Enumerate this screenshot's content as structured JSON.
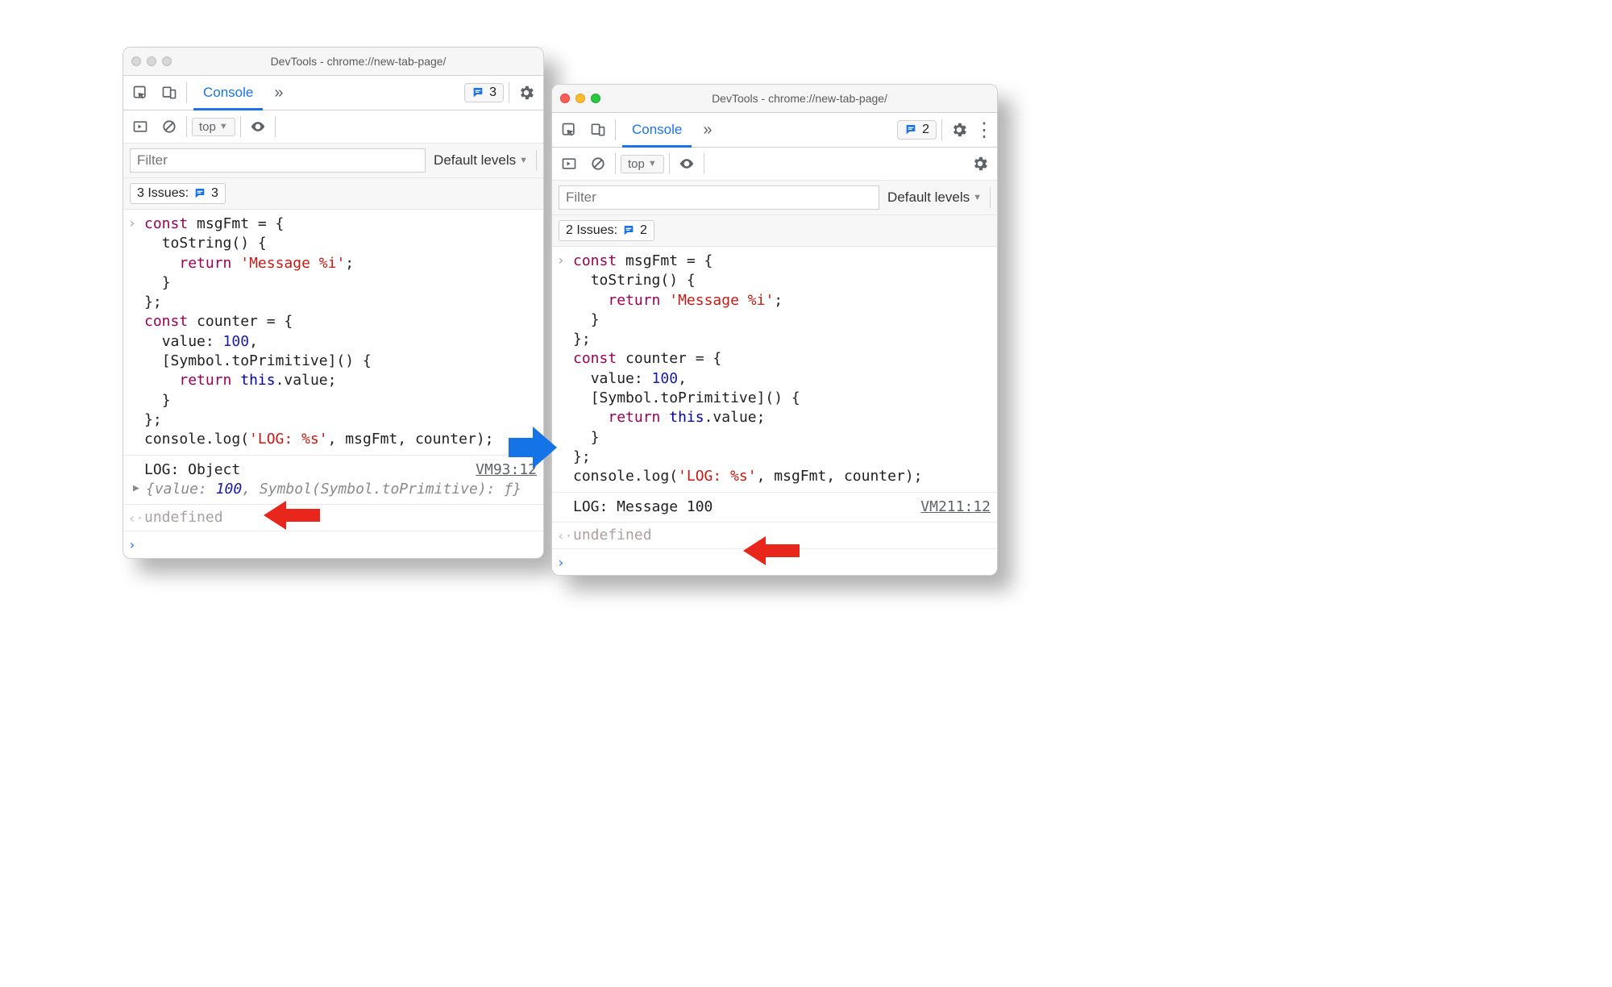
{
  "left": {
    "title": "DevTools - chrome://new-tab-page/",
    "traffic_active": false,
    "tab_label": "Console",
    "tabs_badge_count": 3,
    "context": "top",
    "filter_placeholder": "Filter",
    "levels_label": "Default levels",
    "issues_label": "3 Issues:",
    "issues_count": 3,
    "log_text": "LOG: Object",
    "log_src": "VM93:12",
    "expand_detail_html": "{value: <span class='num'>100</span>, Symbol(Symbol.toPrimitive): ƒ}",
    "undefined_label": "undefined"
  },
  "right": {
    "title": "DevTools - chrome://new-tab-page/",
    "traffic_active": true,
    "tab_label": "Console",
    "tabs_badge_count": 2,
    "context": "top",
    "filter_placeholder": "Filter",
    "levels_label": "Default levels",
    "issues_label": "2 Issues:",
    "issues_count": 2,
    "log_text": "LOG: Message 100",
    "log_src": "VM211:12",
    "undefined_label": "undefined"
  },
  "code_lines": [
    [
      [
        "kw",
        "const"
      ],
      [
        "",
        " msgFmt = {"
      ]
    ],
    [
      [
        "",
        "  toString() {"
      ]
    ],
    [
      [
        "",
        "    "
      ],
      [
        "kw",
        "return"
      ],
      [
        "",
        " "
      ],
      [
        "str",
        "'Message %i'"
      ],
      [
        "",
        ";"
      ]
    ],
    [
      [
        "",
        "  }"
      ]
    ],
    [
      [
        "",
        "};"
      ]
    ],
    [
      [
        "kw",
        "const"
      ],
      [
        "",
        " counter = {"
      ]
    ],
    [
      [
        "",
        "  value: "
      ],
      [
        "num",
        "100"
      ],
      [
        "",
        ","
      ]
    ],
    [
      [
        "",
        "  [Symbol.toPrimitive]() {"
      ]
    ],
    [
      [
        "",
        "    "
      ],
      [
        "kw",
        "return"
      ],
      [
        "",
        " "
      ],
      [
        "kw-this",
        "this"
      ],
      [
        "",
        ".value;"
      ]
    ],
    [
      [
        "",
        "  }"
      ]
    ],
    [
      [
        "",
        "};"
      ]
    ],
    [
      [
        "",
        "console.log("
      ],
      [
        "str",
        "'LOG: %s'"
      ],
      [
        "",
        ", msgFmt, counter);"
      ]
    ]
  ]
}
